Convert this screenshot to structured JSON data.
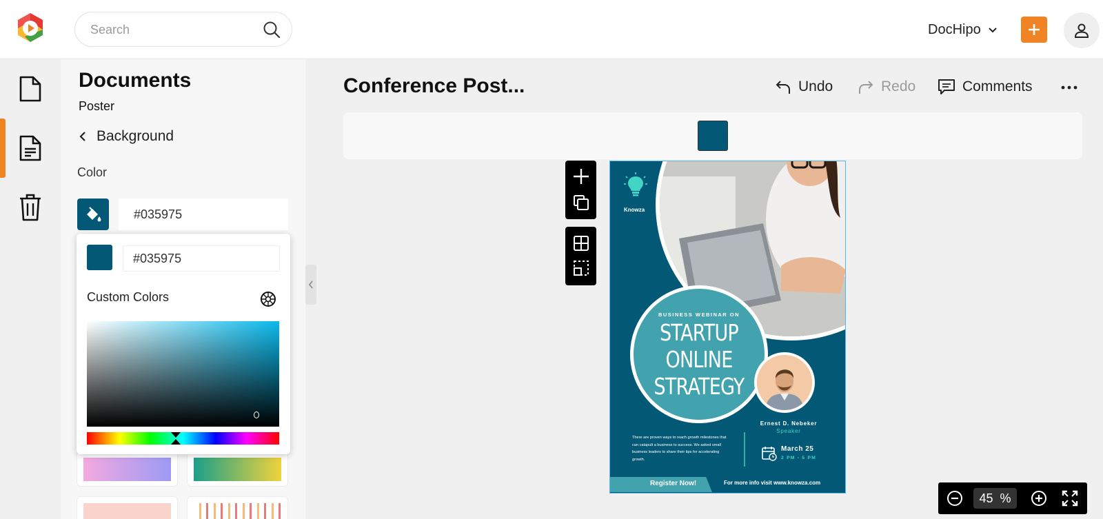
{
  "header": {
    "search_placeholder": "Search",
    "team_name": "DocHipo"
  },
  "rail": {
    "items": [
      "documents",
      "templates",
      "trash"
    ],
    "active_index": 1
  },
  "panel": {
    "title": "Documents",
    "subtitle": "Poster",
    "back_label": "Background",
    "color_label": "Color",
    "color_hex": "#035975"
  },
  "picker": {
    "hex": "#035975",
    "custom_colors_label": "Custom Colors"
  },
  "editor": {
    "doc_title": "Conference Post...",
    "undo_label": "Undo",
    "redo_label": "Redo",
    "comments_label": "Comments",
    "background_color": "#035975"
  },
  "poster": {
    "brand": "Knowza",
    "kicker": "BUSINESS WEBINAR ON",
    "headline": [
      "STARTUP",
      "ONLINE",
      "STRATEGY"
    ],
    "speaker_name": "Ernest D. Nebeker",
    "speaker_role": "Speaker",
    "body": "There are proven ways to reach growth milestones that can catapult a business to success. We asked small business leaders to share their tips for accelerating growth.",
    "date": "March 25",
    "time": "2 PM - 5 PM",
    "register": "Register Now!",
    "more_info": "For more info visit www.knowza.com"
  },
  "zoom": {
    "value": "45",
    "unit": "%"
  },
  "colors": {
    "accent": "#f08324",
    "poster_bg": "#035975",
    "poster_teal": "#42a2ad",
    "poster_green": "#42d4c4"
  }
}
